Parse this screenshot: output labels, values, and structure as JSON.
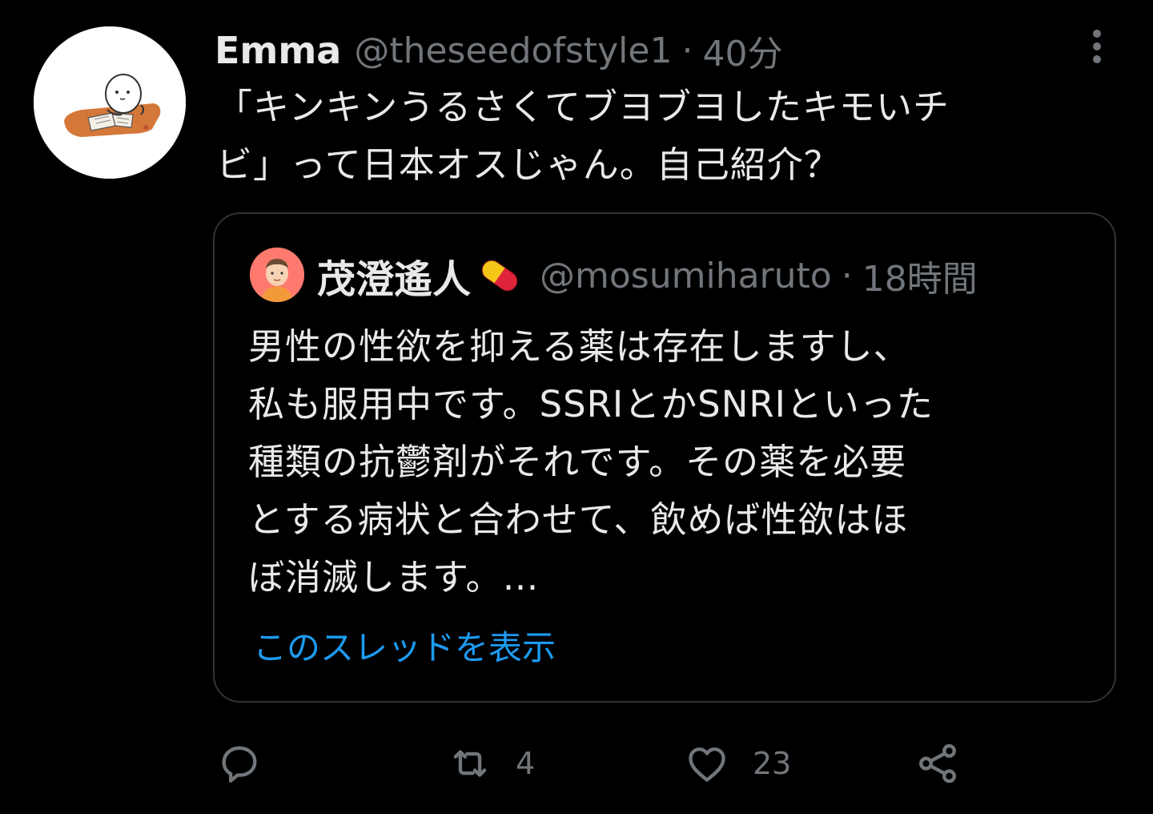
{
  "tweet": {
    "author": {
      "name": "Emma",
      "handle": "@theseedofstyle1",
      "time": "40分",
      "avatar_icon": "avatar-reading-character-icon"
    },
    "separator": "·",
    "text_lines": [
      "「キンキンうるさくてブヨブヨしたキモいチ",
      "ビ」って日本オスじゃん。自己紹介？"
    ],
    "more_icon": "more-vertical-icon"
  },
  "quote": {
    "author": {
      "name": "茂澄遙人",
      "name_icon": "pill-icon",
      "handle": "@mosumiharuto",
      "time": "18時間",
      "avatar_icon": "avatar-man-icon"
    },
    "separator": "·",
    "text_lines": [
      "男性の性欲を抑える薬は存在しますし、",
      "私も服用中です。SSRIとかSNRIといった",
      "種類の抗鬱剤がそれです。その薬を必要",
      "とする病状と合わせて、飲めば性欲はほ",
      "ぼ消滅します。…"
    ],
    "thread_link": "このスレッドを表示"
  },
  "actions": {
    "reply": {
      "icon": "reply-icon",
      "count": ""
    },
    "retweet": {
      "icon": "retweet-icon",
      "count": "4"
    },
    "like": {
      "icon": "heart-icon",
      "count": "23"
    },
    "share": {
      "icon": "share-icon",
      "count": ""
    }
  },
  "colors": {
    "background": "#000000",
    "text": "#e7e9ea",
    "secondary": "#71767b",
    "link": "#1d9bf0",
    "border": "#2f3336"
  }
}
